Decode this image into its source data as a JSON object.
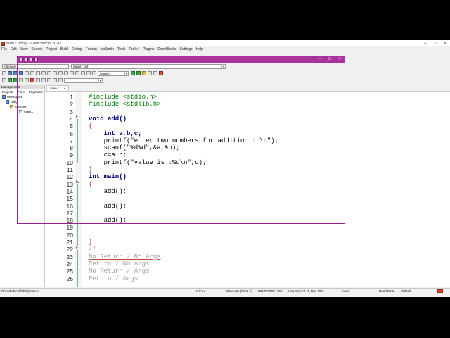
{
  "window": {
    "title": "main.c [hhhg] - Code::Blocks 20.03"
  },
  "menu": [
    "File",
    "Edit",
    "View",
    "Search",
    "Project",
    "Build",
    "Debug",
    "Fortran",
    "wxSmith",
    "Tools",
    "Tools+",
    "Plugins",
    "DoxyBlocks",
    "Settings",
    "Help"
  ],
  "toolbar": {
    "scope_combo": "<global>",
    "function_combo": "main() : int",
    "target_combo": "student"
  },
  "management": {
    "title": "Management",
    "tabs": [
      "Projects",
      "Files",
      "FSymbols"
    ],
    "tree": [
      {
        "label": "Workspace",
        "icon": "workspace-icon"
      },
      {
        "label": "hhhg",
        "icon": "project-icon"
      },
      {
        "label": "Sources",
        "icon": "folder-icon"
      },
      {
        "label": "main.c",
        "icon": "file-icon"
      }
    ]
  },
  "editor": {
    "tab_label": "main.c",
    "tab_close": "×",
    "lines": [
      {
        "n": "1",
        "text": "#include <stdio.h>"
      },
      {
        "n": "2",
        "text": "#include <stdlib.h>"
      },
      {
        "n": "3",
        "text": ""
      },
      {
        "n": "4",
        "text": "void add()"
      },
      {
        "n": "5",
        "text": "{"
      },
      {
        "n": "6",
        "text": "    int a,b,c;"
      },
      {
        "n": "7",
        "text": "    printf(\"enter two numbers for addition : \\n\");"
      },
      {
        "n": "8",
        "text": "    scanf(\"%d%d\",&a,&b);"
      },
      {
        "n": "9",
        "text": "    c=a+b;"
      },
      {
        "n": "10",
        "text": "    printf(\"value is :%d\\n\",c);"
      },
      {
        "n": "11",
        "text": "}"
      },
      {
        "n": "12",
        "text": "int main()"
      },
      {
        "n": "13",
        "text": "{"
      },
      {
        "n": "14",
        "text": "    add();"
      },
      {
        "n": "15",
        "text": ""
      },
      {
        "n": "16",
        "text": "    add();"
      },
      {
        "n": "17",
        "text": ""
      },
      {
        "n": "18",
        "text": "    add();"
      },
      {
        "n": "19",
        "text": ""
      },
      {
        "n": "20",
        "text": ""
      },
      {
        "n": "21",
        "text": "}"
      },
      {
        "n": "22",
        "text": "/*"
      },
      {
        "n": "23",
        "text": "No Return / No Args"
      },
      {
        "n": "24",
        "text": "Return / No Args"
      },
      {
        "n": "25",
        "text": "No Return / Args"
      },
      {
        "n": "26",
        "text": "Return / Args"
      }
    ]
  },
  "popup": {
    "minimize": "–",
    "maximize": "□",
    "close": "×"
  },
  "titlebar_buttons": {
    "minimize": "–",
    "maximize": "□",
    "close": "×"
  },
  "status": {
    "path": "D:\\code block\\hhhg\\main.c",
    "language": "C/C++",
    "eol": "Windows (CR+LF)",
    "encoding": "WINDOWS-1252",
    "position": "Line 18, Col 11, Pos 254",
    "mode": "Insert",
    "access": "Read/Write",
    "theme": "default"
  },
  "colors": {
    "popup_border": "#9b1f8e",
    "popup_bar": "#a8339a",
    "keyword": "#00007f",
    "preprocessor": "#008000",
    "string": "#0000ff",
    "comment": "#a0a0a0"
  }
}
